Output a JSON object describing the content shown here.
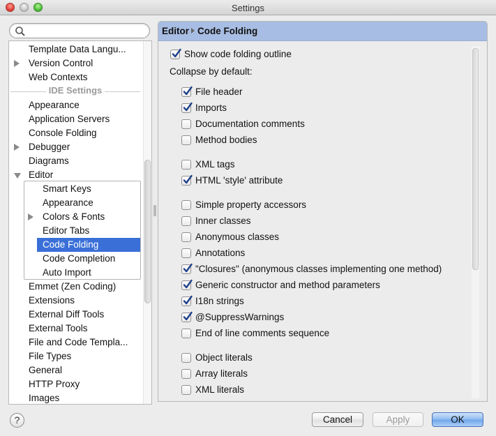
{
  "window": {
    "title": "Settings"
  },
  "search": {
    "placeholder": "",
    "value": ""
  },
  "tree": {
    "items_top": [
      {
        "label": "Template Data Langu...",
        "arrow": "none"
      },
      {
        "label": "Version Control",
        "arrow": "right"
      },
      {
        "label": "Web Contexts",
        "arrow": "none"
      }
    ],
    "section_label": "IDE Settings",
    "items_ide": [
      {
        "label": "Appearance",
        "arrow": "none"
      },
      {
        "label": "Application Servers",
        "arrow": "none"
      },
      {
        "label": "Console Folding",
        "arrow": "none"
      },
      {
        "label": "Debugger",
        "arrow": "right"
      },
      {
        "label": "Diagrams",
        "arrow": "none"
      },
      {
        "label": "Editor",
        "arrow": "down"
      }
    ],
    "editor_children": [
      {
        "label": "Smart Keys",
        "arrow": "none",
        "selected": false
      },
      {
        "label": "Appearance",
        "arrow": "none",
        "selected": false
      },
      {
        "label": "Colors & Fonts",
        "arrow": "right",
        "selected": false
      },
      {
        "label": "Editor Tabs",
        "arrow": "none",
        "selected": false
      },
      {
        "label": "Code Folding",
        "arrow": "none",
        "selected": true
      },
      {
        "label": "Code Completion",
        "arrow": "none",
        "selected": false
      },
      {
        "label": "Auto Import",
        "arrow": "none",
        "selected": false
      }
    ],
    "items_after": [
      {
        "label": "Emmet (Zen Coding)"
      },
      {
        "label": "Extensions"
      },
      {
        "label": "External Diff Tools"
      },
      {
        "label": "External Tools"
      },
      {
        "label": "File and Code Templa..."
      },
      {
        "label": "File Types"
      },
      {
        "label": "General"
      },
      {
        "label": "HTTP Proxy"
      },
      {
        "label": "Images"
      }
    ]
  },
  "panel": {
    "breadcrumb": [
      "Editor",
      "Code Folding"
    ],
    "show_outline": {
      "label": "Show code folding outline",
      "checked": true
    },
    "collapse_heading": "Collapse by default:",
    "groups": [
      [
        {
          "label": "File header",
          "checked": true
        },
        {
          "label": "Imports",
          "checked": true
        },
        {
          "label": "Documentation comments",
          "checked": false
        },
        {
          "label": "Method bodies",
          "checked": false
        }
      ],
      [
        {
          "label": "XML tags",
          "checked": false
        },
        {
          "label": "HTML 'style' attribute",
          "checked": true
        }
      ],
      [
        {
          "label": "Simple property accessors",
          "checked": false
        },
        {
          "label": "Inner classes",
          "checked": false
        },
        {
          "label": "Anonymous classes",
          "checked": false
        },
        {
          "label": "Annotations",
          "checked": false
        },
        {
          "label": "\"Closures\" (anonymous classes implementing one method)",
          "checked": true
        },
        {
          "label": "Generic constructor and method parameters",
          "checked": true
        },
        {
          "label": "I18n strings",
          "checked": true
        },
        {
          "label": "@SuppressWarnings",
          "checked": true
        },
        {
          "label": "End of line comments sequence",
          "checked": false
        }
      ],
      [
        {
          "label": "Object literals",
          "checked": false
        },
        {
          "label": "Array literals",
          "checked": false
        },
        {
          "label": "XML literals",
          "checked": false
        }
      ]
    ]
  },
  "footer": {
    "help_label": "?",
    "cancel_label": "Cancel",
    "apply_label": "Apply",
    "ok_label": "OK"
  },
  "colors": {
    "header_bg": "#a8bde3",
    "selection": "#3a6fd8",
    "checkmark": "#1d3f8a"
  }
}
